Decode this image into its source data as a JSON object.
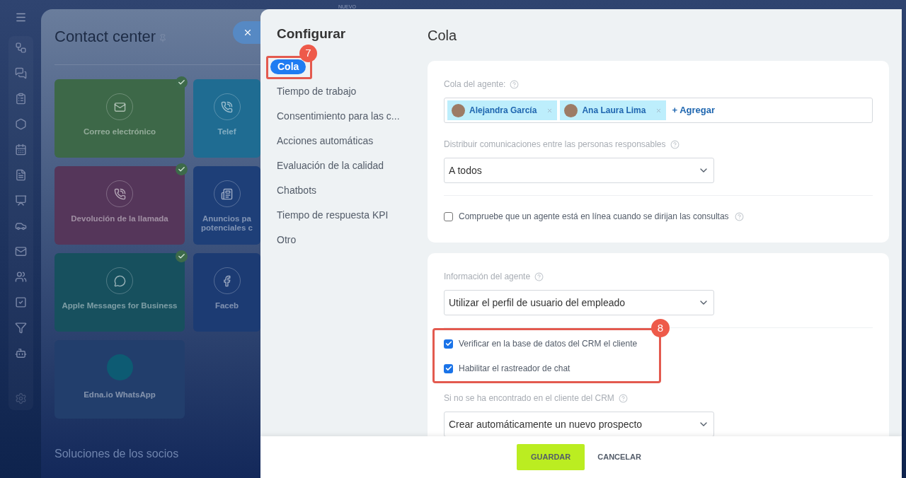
{
  "background_page": {
    "badge": "NUEVO",
    "title": "Contact center",
    "tiles": [
      {
        "label": "Correo electrónico",
        "color": "#3d6848",
        "connected": true
      },
      {
        "label": "Telef",
        "color": "#1f6c92",
        "connected": false
      },
      {
        "label": "Devolución de la llamada",
        "color": "#55365a",
        "connected": true
      },
      {
        "label": "Anuncios pa potenciales c",
        "color": "#1e3f78",
        "connected": false
      },
      {
        "label": "Apple Messages for Business",
        "color": "#17505e",
        "connected": true
      },
      {
        "label": "Faceb",
        "color": "#1c3b73",
        "connected": false
      },
      {
        "label": "Edna.io WhatsApp",
        "color": "#223e6c",
        "connected": false
      }
    ],
    "section_title": "Soluciones de los socios"
  },
  "settings": {
    "nav_title": "Configurar",
    "nav": [
      {
        "label": "Cola",
        "selected": true
      },
      {
        "label": "Tiempo de trabajo",
        "selected": false
      },
      {
        "label": "Consentimiento para las c...",
        "selected": false
      },
      {
        "label": "Acciones automáticas",
        "selected": false
      },
      {
        "label": "Evaluación de la calidad",
        "selected": false
      },
      {
        "label": "Chatbots",
        "selected": false
      },
      {
        "label": "Tiempo de respuesta KPI",
        "selected": false
      },
      {
        "label": "Otro",
        "selected": false
      }
    ],
    "nav_callout": "7",
    "title": "Cola",
    "queue_card": {
      "queue_label": "Cola del agente:",
      "agents": [
        {
          "name": "Alejandra García"
        },
        {
          "name": "Ana Laura Lima"
        }
      ],
      "add_link": "+ Agregar",
      "distribute_label": "Distribuir comunicaciones entre las personas responsables",
      "distribute_value": "A todos",
      "check_online": {
        "label": "Compruebe que un agente está en línea cuando se dirijan las consultas",
        "checked": false
      }
    },
    "agent_card": {
      "info_label": "Información del agente",
      "info_value": "Utilizar el perfil de usuario del empleado",
      "callout": "8",
      "options": [
        {
          "label": "Verificar en la base de datos del CRM el cliente",
          "checked": true
        },
        {
          "label": "Habilitar el rastreador de chat",
          "checked": true
        }
      ],
      "not_found_label": "Si no se ha encontrado en el cliente del CRM",
      "not_found_value": "Crear automáticamente un nuevo prospecto"
    },
    "buttons": {
      "save": "GUARDAR",
      "cancel": "CANCELAR"
    }
  }
}
